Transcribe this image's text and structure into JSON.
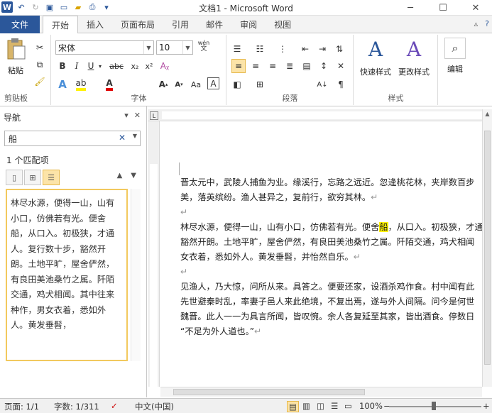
{
  "window": {
    "title": "文档1 - Microsoft Word",
    "minimize": "─",
    "maximize": "☐",
    "close": "✕"
  },
  "tabs": {
    "file": "文件",
    "items": [
      "开始",
      "插入",
      "页面布局",
      "引用",
      "邮件",
      "审阅",
      "视图"
    ]
  },
  "ribbon": {
    "clipboard": {
      "label": "剪贴板",
      "paste": "粘贴"
    },
    "font": {
      "label": "字体",
      "name": "宋体",
      "size": "10",
      "wen": "wén"
    },
    "paragraph": {
      "label": "段落"
    },
    "styles": {
      "label": "样式",
      "quick": "快速样式",
      "change": "更改样式"
    },
    "editing": {
      "label": "编辑"
    }
  },
  "nav": {
    "title": "导航",
    "search_value": "船",
    "match_count": "1 个匹配项",
    "result_lines": [
      "林尽水源，便得一山，山有",
      "小口，仿佛若有光。便舍",
      "船，从口入。初极狭，才通",
      "人。复行数十步，豁然开",
      "朗。土地平旷，屋舍俨然，",
      "有良田美池桑竹之属。阡陌",
      "交通，鸡犬相闻。其中往来",
      "种作，男女衣着，悉如外",
      "人。黄发垂髫，"
    ]
  },
  "document": {
    "p1": [
      "晋太元中，武陵人捕鱼为业。缘溪行，忘路之远近。忽逢桃花林，夹岸数百步",
      "美，落英缤纷。渔人甚异之，复前行，欲穷其林。"
    ],
    "p2_line1_before": "林尽水源，便得一山，山有小口，仿佛若有光。便舍",
    "p2_highlight": "船",
    "p2_line1_after": "，从口入。初极狭，才通人",
    "p2": [
      "豁然开朗。土地平旷，屋舍俨然，有良田美池桑竹之属。阡陌交通，鸡犬相闻",
      "女衣着，悉如外人。黄发垂髫，并怡然自乐。"
    ],
    "p3": [
      "见渔人，乃大惊，问所从来。具答之。便要还家，设酒杀鸡作食。村中闻有此",
      "先世避秦时乱，率妻子邑人来此绝境，不复出焉，遂与外人间隔。问今是何世",
      "魏晋。此人一一为具言所闻，皆叹惋。余人各复延至其家，皆出酒食。停数日",
      "“不足为外人道也。”"
    ],
    "para_mark": "↵"
  },
  "status": {
    "page": "页面: 1/1",
    "words": "字数: 1/311",
    "lang": "中文(中国)",
    "zoom": "100%"
  }
}
